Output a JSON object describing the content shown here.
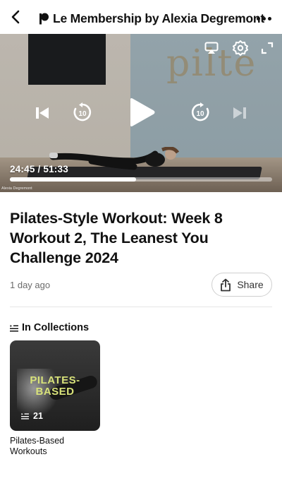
{
  "header": {
    "title": "Le Membership by Alexia Degremont",
    "back_icon": "chevron-left-icon",
    "brand_icon": "patreon-logo-icon",
    "more_icon": "more-horizontal-icon"
  },
  "video": {
    "current_time": "24:45",
    "duration": "51:33",
    "time_display": "24:45 / 51:33",
    "progress_fraction": 0.48,
    "watermark": "Alexia Degremont",
    "controls": {
      "airplay_icon": "airplay-icon",
      "settings_icon": "settings-gear-icon",
      "fullscreen_icon": "fullscreen-icon",
      "previous_icon": "skip-previous-icon",
      "rewind_icon": "rewind-10-icon",
      "rewind_seconds": "10",
      "play_icon": "play-icon",
      "forward_icon": "forward-10-icon",
      "forward_seconds": "10",
      "next_icon": "skip-next-icon"
    }
  },
  "post": {
    "title": "Pilates-Style Workout: Week 8 Workout 2, The Leanest You Challenge 2024",
    "age": "1 day ago",
    "share_label": "Share",
    "share_icon": "share-icon"
  },
  "collections": {
    "heading": "In Collections",
    "heading_icon": "collection-list-icon",
    "items": [
      {
        "cover_text_line1": "PILATES-",
        "cover_text_line2": "BASED",
        "count": "21",
        "title": "Pilates-Based Workouts"
      }
    ]
  },
  "colors": {
    "accent_card_text": "#d8e27a",
    "text_primary": "#111111",
    "text_secondary": "#6b6b6b"
  }
}
